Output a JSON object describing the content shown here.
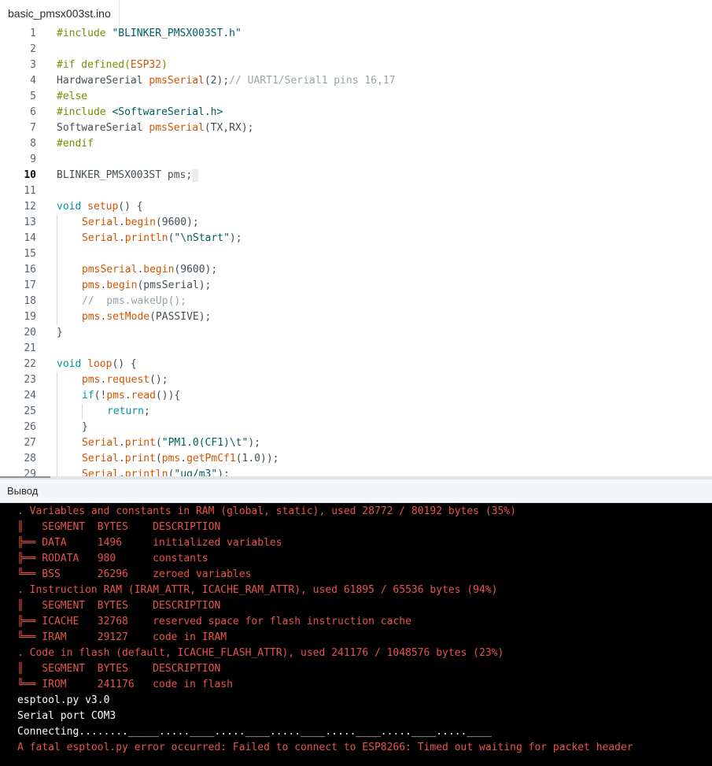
{
  "tab": {
    "filename": "basic_pmsx003st.ino"
  },
  "output_title": "Вывод",
  "editor": {
    "active_line": 10,
    "lines": [
      {
        "n": "1",
        "indent": 0,
        "tokens": [
          {
            "c": "macro",
            "t": "#include "
          },
          {
            "c": "str",
            "t": "\"BLINKER_PMSX003ST.h\""
          }
        ]
      },
      {
        "n": "2",
        "indent": 0,
        "tokens": []
      },
      {
        "n": "3",
        "indent": 0,
        "tokens": [
          {
            "c": "macro",
            "t": "#if defined("
          },
          {
            "c": "fn",
            "t": "ESP32"
          },
          {
            "c": "macro",
            "t": ")"
          }
        ]
      },
      {
        "n": "4",
        "indent": 0,
        "tokens": [
          {
            "c": "type",
            "t": "HardwareSerial "
          },
          {
            "c": "fn",
            "t": "pmsSerial"
          },
          {
            "c": "type",
            "t": "(2);"
          },
          {
            "c": "cmt",
            "t": "// UART1/Serial1 pins 16,17"
          }
        ]
      },
      {
        "n": "5",
        "indent": 0,
        "tokens": [
          {
            "c": "macro",
            "t": "#else"
          }
        ]
      },
      {
        "n": "6",
        "indent": 0,
        "tokens": [
          {
            "c": "macro",
            "t": "#include "
          },
          {
            "c": "str",
            "t": "<SoftwareSerial.h>"
          }
        ]
      },
      {
        "n": "7",
        "indent": 0,
        "tokens": [
          {
            "c": "type",
            "t": "SoftwareSerial "
          },
          {
            "c": "fn",
            "t": "pmsSerial"
          },
          {
            "c": "type",
            "t": "(TX,RX);"
          }
        ]
      },
      {
        "n": "8",
        "indent": 0,
        "tokens": [
          {
            "c": "macro",
            "t": "#endif"
          }
        ]
      },
      {
        "n": "9",
        "indent": 0,
        "tokens": []
      },
      {
        "n": "10",
        "indent": 0,
        "tokens": [
          {
            "c": "type",
            "t": "BLINKER_PMSX003ST pms;"
          }
        ],
        "cursor": true
      },
      {
        "n": "11",
        "indent": 0,
        "tokens": []
      },
      {
        "n": "12",
        "indent": 0,
        "tokens": [
          {
            "c": "kw",
            "t": "void "
          },
          {
            "c": "fn",
            "t": "setup"
          },
          {
            "c": "type",
            "t": "() {"
          }
        ]
      },
      {
        "n": "13",
        "indent": 1,
        "tokens": [
          {
            "c": "fn",
            "t": "Serial"
          },
          {
            "c": "type",
            "t": "."
          },
          {
            "c": "fn",
            "t": "begin"
          },
          {
            "c": "type",
            "t": "(9600);"
          }
        ]
      },
      {
        "n": "14",
        "indent": 1,
        "tokens": [
          {
            "c": "fn",
            "t": "Serial"
          },
          {
            "c": "type",
            "t": "."
          },
          {
            "c": "fn",
            "t": "println"
          },
          {
            "c": "type",
            "t": "("
          },
          {
            "c": "str",
            "t": "\"\\nStart\""
          },
          {
            "c": "type",
            "t": ");"
          }
        ]
      },
      {
        "n": "15",
        "indent": 1,
        "tokens": []
      },
      {
        "n": "16",
        "indent": 1,
        "tokens": [
          {
            "c": "fn",
            "t": "pmsSerial"
          },
          {
            "c": "type",
            "t": "."
          },
          {
            "c": "fn",
            "t": "begin"
          },
          {
            "c": "type",
            "t": "(9600);"
          }
        ]
      },
      {
        "n": "17",
        "indent": 1,
        "tokens": [
          {
            "c": "fn",
            "t": "pms"
          },
          {
            "c": "type",
            "t": "."
          },
          {
            "c": "fn",
            "t": "begin"
          },
          {
            "c": "type",
            "t": "(pmsSerial);"
          }
        ]
      },
      {
        "n": "18",
        "indent": 1,
        "tokens": [
          {
            "c": "cmt",
            "t": "//  pms.wakeUp();"
          }
        ]
      },
      {
        "n": "19",
        "indent": 1,
        "tokens": [
          {
            "c": "fn",
            "t": "pms"
          },
          {
            "c": "type",
            "t": "."
          },
          {
            "c": "fn",
            "t": "setMode"
          },
          {
            "c": "type",
            "t": "(PASSIVE);"
          }
        ]
      },
      {
        "n": "20",
        "indent": 0,
        "tokens": [
          {
            "c": "type",
            "t": "}"
          }
        ]
      },
      {
        "n": "21",
        "indent": 0,
        "tokens": []
      },
      {
        "n": "22",
        "indent": 0,
        "tokens": [
          {
            "c": "kw",
            "t": "void "
          },
          {
            "c": "fn",
            "t": "loop"
          },
          {
            "c": "type",
            "t": "() {"
          }
        ]
      },
      {
        "n": "23",
        "indent": 1,
        "tokens": [
          {
            "c": "fn",
            "t": "pms"
          },
          {
            "c": "type",
            "t": "."
          },
          {
            "c": "fn",
            "t": "request"
          },
          {
            "c": "type",
            "t": "();"
          }
        ]
      },
      {
        "n": "24",
        "indent": 1,
        "tokens": [
          {
            "c": "kw",
            "t": "if"
          },
          {
            "c": "type",
            "t": "(!"
          },
          {
            "c": "fn",
            "t": "pms"
          },
          {
            "c": "type",
            "t": "."
          },
          {
            "c": "fn",
            "t": "read"
          },
          {
            "c": "type",
            "t": "()){"
          }
        ]
      },
      {
        "n": "25",
        "indent": 2,
        "tokens": [
          {
            "c": "kw",
            "t": "return"
          },
          {
            "c": "type",
            "t": ";"
          }
        ]
      },
      {
        "n": "26",
        "indent": 1,
        "tokens": [
          {
            "c": "type",
            "t": "}"
          }
        ]
      },
      {
        "n": "27",
        "indent": 1,
        "tokens": [
          {
            "c": "fn",
            "t": "Serial"
          },
          {
            "c": "type",
            "t": "."
          },
          {
            "c": "fn",
            "t": "print"
          },
          {
            "c": "type",
            "t": "("
          },
          {
            "c": "str",
            "t": "\"PM1.0(CF1)\\t\""
          },
          {
            "c": "type",
            "t": ");"
          }
        ]
      },
      {
        "n": "28",
        "indent": 1,
        "tokens": [
          {
            "c": "fn",
            "t": "Serial"
          },
          {
            "c": "type",
            "t": "."
          },
          {
            "c": "fn",
            "t": "print"
          },
          {
            "c": "type",
            "t": "("
          },
          {
            "c": "fn",
            "t": "pms"
          },
          {
            "c": "type",
            "t": "."
          },
          {
            "c": "fn",
            "t": "getPmCf1"
          },
          {
            "c": "type",
            "t": "(1.0));"
          }
        ]
      },
      {
        "n": "29",
        "indent": 1,
        "tokens": [
          {
            "c": "fn",
            "t": "Serial"
          },
          {
            "c": "type",
            "t": "."
          },
          {
            "c": "fn",
            "t": "println"
          },
          {
            "c": "type",
            "t": "("
          },
          {
            "c": "str",
            "t": "\"ug/m3\""
          },
          {
            "c": "type",
            "t": ");"
          }
        ]
      }
    ]
  },
  "console": {
    "lines": [
      {
        "c": "red",
        "t": ". Variables and constants in RAM (global, static), used 28772 / 80192 bytes (35%)"
      },
      {
        "c": "red",
        "t": "║   SEGMENT  BYTES    DESCRIPTION"
      },
      {
        "c": "red",
        "t": "╠══ DATA     1496     initialized variables"
      },
      {
        "c": "red",
        "t": "╠══ RODATA   980      constants"
      },
      {
        "c": "red",
        "t": "╚══ BSS      26296    zeroed variables"
      },
      {
        "c": "red",
        "t": ". Instruction RAM (IRAM_ATTR, ICACHE_RAM_ATTR), used 61895 / 65536 bytes (94%)"
      },
      {
        "c": "red",
        "t": "║   SEGMENT  BYTES    DESCRIPTION"
      },
      {
        "c": "red",
        "t": "╠══ ICACHE   32768    reserved space for flash instruction cache"
      },
      {
        "c": "red",
        "t": "╚══ IRAM     29127    code in IRAM"
      },
      {
        "c": "red",
        "t": ". Code in flash (default, ICACHE_FLASH_ATTR), used 241176 / 1048576 bytes (23%)"
      },
      {
        "c": "red",
        "t": "║   SEGMENT  BYTES    DESCRIPTION"
      },
      {
        "c": "red",
        "t": "╚══ IROM     241176   code in flash"
      },
      {
        "c": "white",
        "t": "esptool.py v3.0"
      },
      {
        "c": "white",
        "t": "Serial port COM3"
      },
      {
        "c": "white",
        "t": "Connecting........_____.....____.....____.....____.....____.....____.....____"
      },
      {
        "c": "red",
        "t": "A fatal esptool.py error occurred: Failed to connect to ESP8266: Timed out waiting for packet header"
      }
    ]
  }
}
